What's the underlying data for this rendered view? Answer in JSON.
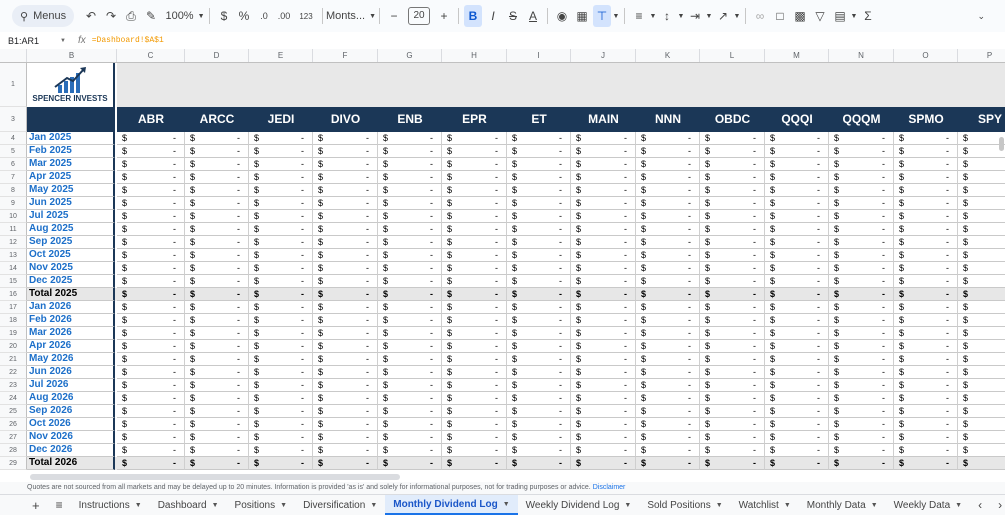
{
  "toolbar": {
    "menus_label": "Menus",
    "zoom": "100%",
    "currency": "$",
    "percent": "%",
    "dec_decrease": ".0",
    "dec_increase": ".00",
    "format_123": "123",
    "font": "Monts...",
    "font_size": "20",
    "bold": "B",
    "italic": "I",
    "strike": "S",
    "text_color": "A",
    "sigma": "Σ"
  },
  "formula_bar": {
    "name_box": "B1:AR1",
    "fx": "fx",
    "formula": "=Dashboard!$A$1"
  },
  "columns": [
    "B",
    "C",
    "D",
    "E",
    "F",
    "G",
    "H",
    "I",
    "J",
    "K",
    "L",
    "M",
    "N",
    "O",
    "P"
  ],
  "logo": {
    "text": "SPENCER INVESTS"
  },
  "tickers": [
    "ABR",
    "ARCC",
    "JEDI",
    "DIVO",
    "ENB",
    "EPR",
    "ET",
    "MAIN",
    "NNN",
    "OBDC",
    "QQQI",
    "QQQM",
    "SPMO",
    "SPY"
  ],
  "rows": [
    {
      "num": "4",
      "month": "Jan 2025",
      "total": false
    },
    {
      "num": "5",
      "month": "Feb 2025",
      "total": false
    },
    {
      "num": "6",
      "month": "Mar 2025",
      "total": false
    },
    {
      "num": "7",
      "month": "Apr 2025",
      "total": false
    },
    {
      "num": "8",
      "month": "May 2025",
      "total": false
    },
    {
      "num": "9",
      "month": "Jun 2025",
      "total": false
    },
    {
      "num": "10",
      "month": "Jul 2025",
      "total": false
    },
    {
      "num": "11",
      "month": "Aug 2025",
      "total": false
    },
    {
      "num": "12",
      "month": "Sep 2025",
      "total": false
    },
    {
      "num": "13",
      "month": "Oct 2025",
      "total": false
    },
    {
      "num": "14",
      "month": "Nov 2025",
      "total": false
    },
    {
      "num": "15",
      "month": "Dec 2025",
      "total": false
    },
    {
      "num": "16",
      "month": "Total 2025",
      "total": true
    },
    {
      "num": "17",
      "month": "Jan 2026",
      "total": false
    },
    {
      "num": "18",
      "month": "Feb 2026",
      "total": false
    },
    {
      "num": "19",
      "month": "Mar 2026",
      "total": false
    },
    {
      "num": "20",
      "month": "Apr 2026",
      "total": false
    },
    {
      "num": "21",
      "month": "May 2026",
      "total": false
    },
    {
      "num": "22",
      "month": "Jun 2026",
      "total": false
    },
    {
      "num": "23",
      "month": "Jul 2026",
      "total": false
    },
    {
      "num": "24",
      "month": "Aug 2026",
      "total": false
    },
    {
      "num": "25",
      "month": "Sep 2026",
      "total": false
    },
    {
      "num": "26",
      "month": "Oct 2026",
      "total": false
    },
    {
      "num": "27",
      "month": "Nov 2026",
      "total": false
    },
    {
      "num": "28",
      "month": "Dec 2026",
      "total": false
    },
    {
      "num": "29",
      "month": "Total 2026",
      "total": true
    }
  ],
  "cell": {
    "dollar": "$",
    "value": "-"
  },
  "row_labels": {
    "r1": "1",
    "r3": "3"
  },
  "notice": {
    "text": "Quotes are not sourced from all markets and may be delayed up to 20 minutes. Information is provided 'as is' and solely for informational purposes, not for trading purposes or advice.",
    "link": "Disclaimer"
  },
  "tabs": [
    {
      "label": "Instructions"
    },
    {
      "label": "Dashboard"
    },
    {
      "label": "Positions"
    },
    {
      "label": "Diversification"
    },
    {
      "label": "Monthly Dividend Log",
      "active": true
    },
    {
      "label": "Weekly Dividend Log"
    },
    {
      "label": "Sold Positions"
    },
    {
      "label": "Watchlist"
    },
    {
      "label": "Monthly Data"
    },
    {
      "label": "Weekly Data"
    }
  ],
  "colors": {
    "navy": "#1b3757",
    "month_blue": "#1c6fc9",
    "active_tab": "#1a56c8"
  }
}
